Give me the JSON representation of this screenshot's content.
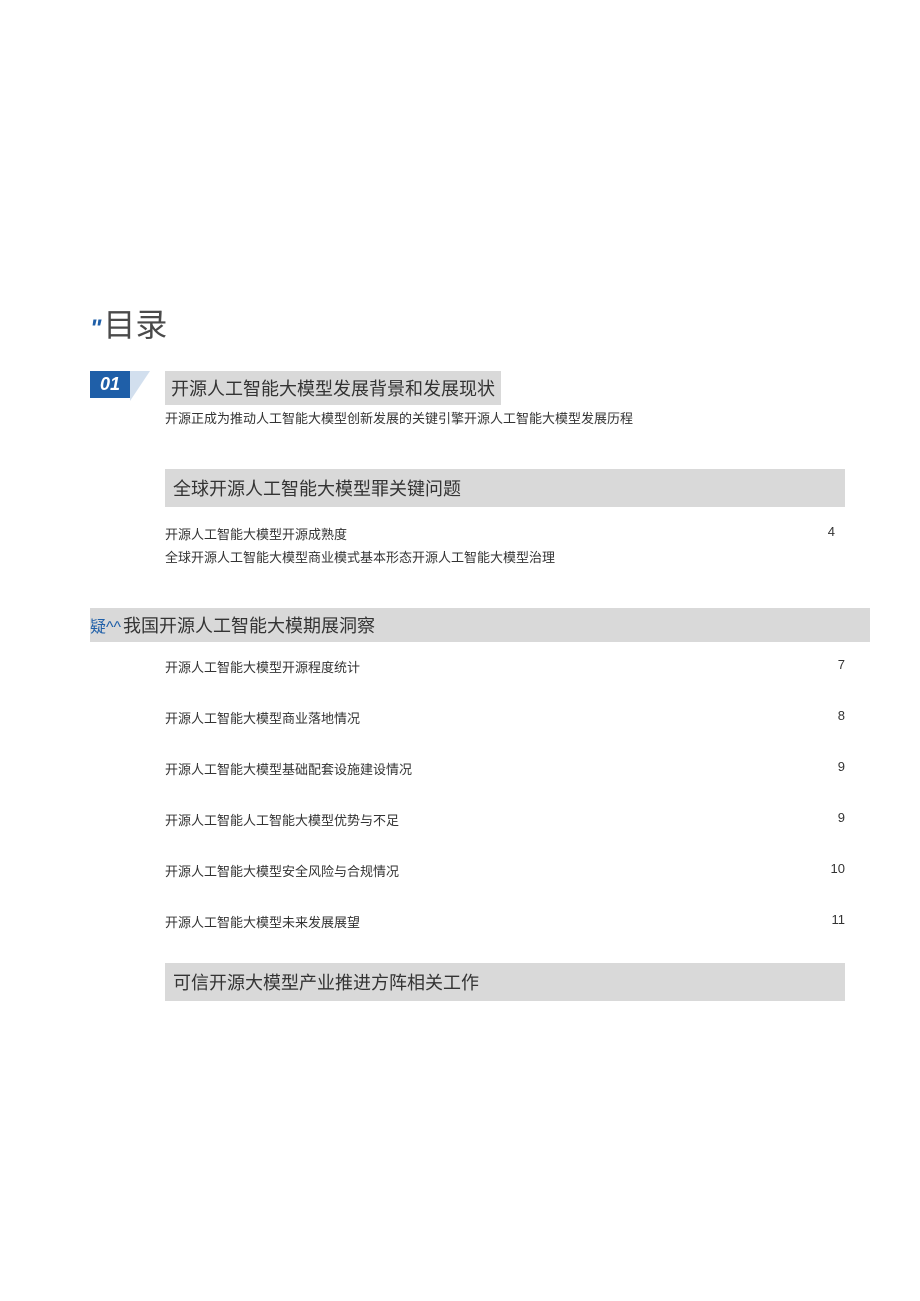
{
  "title": {
    "quote": "\"",
    "text": "目录"
  },
  "section1": {
    "badge": "01",
    "heading": "开源人工智能大模型发展背景和发展现状",
    "subtext": "开源正成为推动人工智能大模型创新发展的关键引擎开源人工智能大模型发展历程"
  },
  "section2": {
    "heading": "全球开源人工智能大模型罪关键问题",
    "items": [
      {
        "label": "开源人工智能大模型开源成熟度",
        "page": "4"
      },
      {
        "label": "全球开源人工智能大模型商业模式基本形态开源人工智能大模型治理",
        "page": ""
      }
    ]
  },
  "section3": {
    "prefix": "疑^^",
    "heading": "我国开源人工智能大模期展洞察",
    "items": [
      {
        "label": "开源人工智能大模型开源程度统计",
        "page": "7"
      },
      {
        "label": "开源人工智能大模型商业落地情况",
        "page": "8"
      },
      {
        "label": "开源人工智能大模型基础配套设施建设情况",
        "page": "9"
      },
      {
        "label": "开源人工智能人工智能大模型优势与不足",
        "page": "9"
      },
      {
        "label": "开源人工智能大模型安全风险与合规情况",
        "page": "10"
      },
      {
        "label": "开源人工智能大模型未来发展展望",
        "page": "11"
      }
    ]
  },
  "section4": {
    "heading": "可信开源大模型产业推进方阵相关工作"
  }
}
